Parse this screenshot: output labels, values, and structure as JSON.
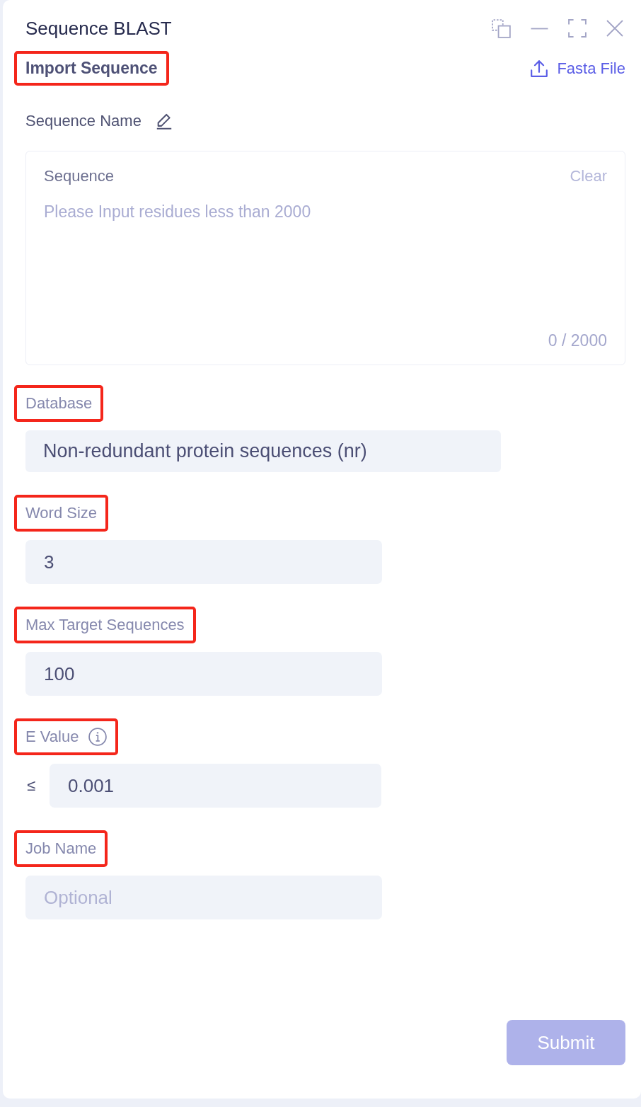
{
  "window": {
    "title": "Sequence BLAST"
  },
  "import": {
    "title": "Import Sequence",
    "highlighted": true,
    "fasta_button": "Fasta File"
  },
  "sequence_name": {
    "label": "Sequence Name"
  },
  "sequence": {
    "label": "Sequence",
    "clear": {
      "label": "Clear",
      "disabled": true
    },
    "placeholder": "Please Input residues less than 2000",
    "counter": "0 / 2000"
  },
  "fields": [
    {
      "kind": "select",
      "label": "Database",
      "highlighted": true,
      "value": "Non-redundant protein sequences (nr)"
    },
    {
      "kind": "input",
      "label": "Word Size",
      "highlighted": true,
      "value": "3"
    },
    {
      "kind": "input",
      "label": "Max Target Sequences",
      "highlighted": true,
      "value": "100"
    },
    {
      "kind": "threshold",
      "label": "E Value",
      "highlighted": true,
      "prefix": "≤",
      "value": "0.001"
    },
    {
      "kind": "input",
      "label": "Job Name",
      "highlighted": true,
      "placeholder": "Optional"
    }
  ],
  "submit": {
    "label": "Submit",
    "disabled": true
  }
}
